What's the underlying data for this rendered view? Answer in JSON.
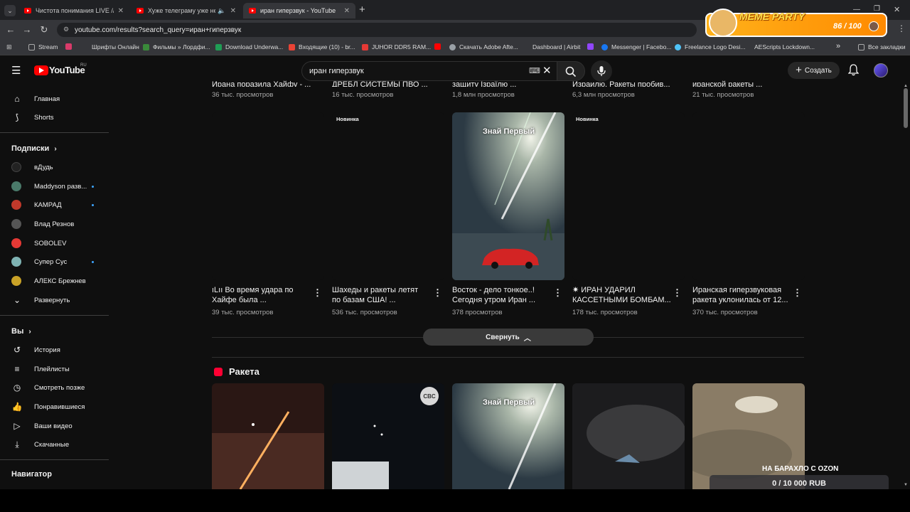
{
  "browser": {
    "tabs": [
      {
        "title": "Чистота понимания LIVE // Ес"
      },
      {
        "title": "Хуже телеграму уже не бу"
      },
      {
        "title": "иран гиперзвук - YouTube"
      }
    ],
    "new_tab": "+",
    "url": "youtube.com/results?search_query=иран+гиперзвук",
    "bookmarks": [
      {
        "label": "Stream",
        "color": "#8ab4f8"
      },
      {
        "label": "",
        "color": "#d93b6a"
      },
      {
        "label": "Шрифты Онлайн",
        "color": "#333333"
      },
      {
        "label": "Фильмы » Лордфи...",
        "color": "#3a8a3a"
      },
      {
        "label": "Download Underwa...",
        "color": "#1f9d55"
      },
      {
        "label": "Входящие (10) - br...",
        "color": "#ea4335"
      },
      {
        "label": "JUHOR DDR5 RAM...",
        "color": "#e53935"
      },
      {
        "label": "",
        "color": "#ff0000"
      },
      {
        "label": "Скачать Adobe Afte...",
        "color": "#9aa0a6"
      },
      {
        "label": "Dashboard | Airbit",
        "color": "#35363a"
      },
      {
        "label": "",
        "color": "#9146ff"
      },
      {
        "label": "Messenger | Facebo...",
        "color": "#1877f2"
      },
      {
        "label": "Freelance Logo Desi...",
        "color": "#4fc3f7"
      },
      {
        "label": "AEScripts Lockdown...",
        "color": "#222222"
      }
    ],
    "bookmarks_more": "»",
    "all_bookmarks": "Все закладки"
  },
  "overlay": {
    "meme_title": "MEME PARTY",
    "meme_count": "86 / 100",
    "donation_title": "НА БАРАХЛО С OZON",
    "donation_progress": "0 / 10 000 RUB"
  },
  "youtube": {
    "logo": "YouTube",
    "region": "RU",
    "search_value": "иран гиперзвук",
    "create_label": "Создать"
  },
  "sidebar": {
    "main": [
      {
        "label": "Главная",
        "icon": "home-icon"
      },
      {
        "label": "Shorts",
        "icon": "shorts-icon"
      }
    ],
    "subs_header": "Подписки",
    "subs": [
      {
        "label": "вДудь",
        "color": "#222222",
        "dot": false
      },
      {
        "label": "Maddyson разв...",
        "color": "#4a7a6a",
        "dot": true
      },
      {
        "label": "КАМРАД",
        "color": "#c0392b",
        "dot": true
      },
      {
        "label": "Влад Резнов",
        "color": "#555555",
        "dot": false
      },
      {
        "label": "SOBOLEV",
        "color": "#e53935",
        "dot": false
      },
      {
        "label": "Супер Сус",
        "color": "#7fb3b3",
        "dot": true
      },
      {
        "label": "АЛЕКС Брежнев",
        "color": "#c9a227",
        "dot": false
      }
    ],
    "expand_label": "Развернуть",
    "you_header": "Вы",
    "you": [
      {
        "label": "История",
        "icon": "history-icon"
      },
      {
        "label": "Плейлисты",
        "icon": "playlists-icon"
      },
      {
        "label": "Смотреть позже",
        "icon": "watch-later-icon"
      },
      {
        "label": "Понравившиеся",
        "icon": "like-icon"
      },
      {
        "label": "Ваши видео",
        "icon": "your-videos-icon"
      },
      {
        "label": "Скачанные",
        "icon": "downloads-icon"
      }
    ],
    "nav_header": "Навигатор"
  },
  "results": {
    "top_row": [
      {
        "title": "Ирана поразила Хайфу - ...",
        "views": "36 тыс. просмотров"
      },
      {
        "title": "ДРЕБЛ СИСТЕМЫ ПВО ...",
        "views": "16 тыс. просмотров"
      },
      {
        "title": "защиту Ізраїлю ...",
        "views": "1,8 млн просмотров"
      },
      {
        "title": "Израилю. Ракеты пробив...",
        "views": "6,3 млн просмотров"
      },
      {
        "title": "иранской ракеты ...",
        "views": "21 тыс. просмотров"
      }
    ],
    "shorts_row": [
      {
        "badge": "",
        "overlay_text": "",
        "title_l1": "ıLıı Во время удара по",
        "title_l2": "Хайфе была ...",
        "views": "39 тыс. просмотров"
      },
      {
        "badge": "Новинка",
        "overlay_text": "",
        "title_l1": "Шахеды и ракеты летят",
        "title_l2": "по базам США! ...",
        "views": "536 тыс. просмотров"
      },
      {
        "badge": "",
        "overlay_text": "Знай Первый",
        "title_l1": "Восток - дело тонкое..!",
        "title_l2": "Сегодня утром Иран ...",
        "views": "378 просмотров"
      },
      {
        "badge": "Новинка",
        "overlay_text": "",
        "title_l1": "✷ ИРАН УДАРИЛ",
        "title_l2": "КАССЕТНЫМИ БОМБАМ...",
        "views": "178 тыс. просмотров"
      },
      {
        "badge": "",
        "overlay_text": "",
        "title_l1": "Иранская гиперзвуковая",
        "title_l2": "ракета уклонилась от 12...",
        "views": "370 тыс. просмотров"
      }
    ],
    "collapse_label": "Свернуть",
    "shelf_title": "Ракета",
    "shelf_thumbs": [
      {
        "overlay_text": ""
      },
      {
        "overlay_text": "CBC"
      },
      {
        "overlay_text": "Знай Первый"
      },
      {
        "overlay_text": ""
      },
      {
        "overlay_text": ""
      }
    ]
  }
}
